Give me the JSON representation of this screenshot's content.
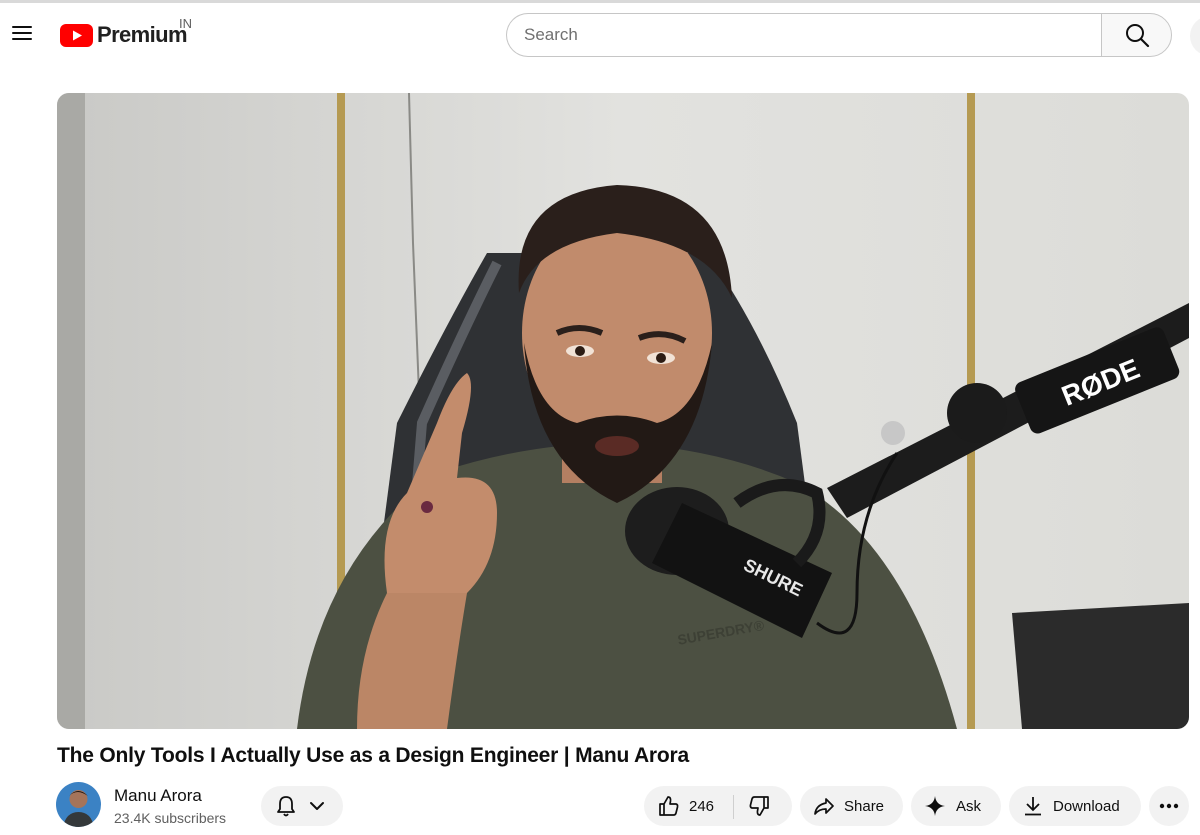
{
  "masthead": {
    "logo_word": "Premium",
    "country_code": "IN",
    "search_placeholder": "Search",
    "brand_color": "#ff0000"
  },
  "video": {
    "title": "The Only Tools I Actually Use as a Design Engineer | Manu Arora",
    "frame_text": {
      "mic_arm_brand": "RØDE",
      "mic_brand": "SHURE",
      "shirt_brand": "SUPERDRY®"
    }
  },
  "channel": {
    "name": "Manu Arora",
    "subscribers": "23.4K subscribers"
  },
  "actions": {
    "like_count": "246",
    "share_label": "Share",
    "ask_label": "Ask",
    "download_label": "Download"
  },
  "icons": [
    "menu-icon",
    "youtube-logo-icon",
    "search-icon",
    "bell-icon",
    "chevron-down-icon",
    "thumbs-up-icon",
    "thumbs-down-icon",
    "share-arrow-icon",
    "sparkle-icon",
    "download-icon",
    "more-dots-icon"
  ]
}
